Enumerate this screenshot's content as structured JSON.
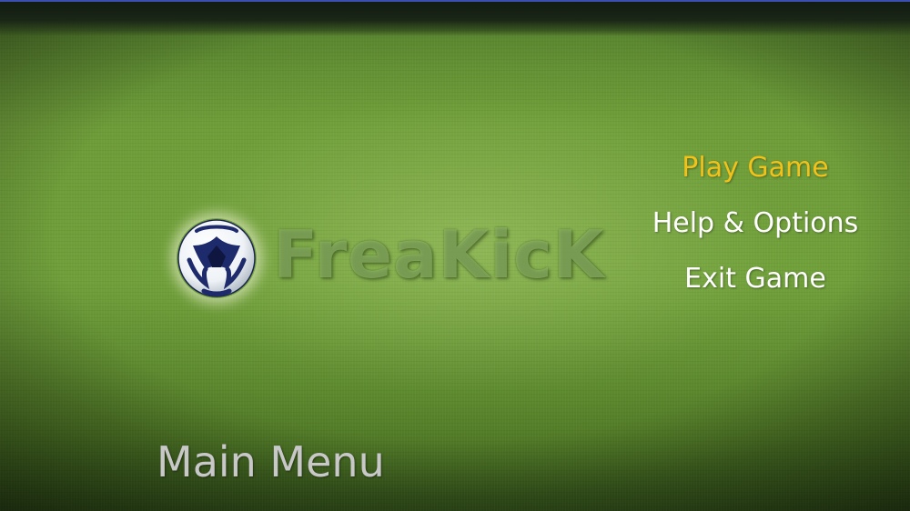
{
  "game": {
    "logo_text": "FreaKicK",
    "screen_title": "Main Menu"
  },
  "menu": {
    "items": [
      {
        "label": "Play Game",
        "selected": true
      },
      {
        "label": "Help & Options",
        "selected": false
      },
      {
        "label": "Exit Game",
        "selected": false
      }
    ],
    "selected_color": "#f2c21a",
    "item_color": "#ffffff"
  },
  "icons": {
    "logo_icon": "soccer-ball-icon"
  }
}
